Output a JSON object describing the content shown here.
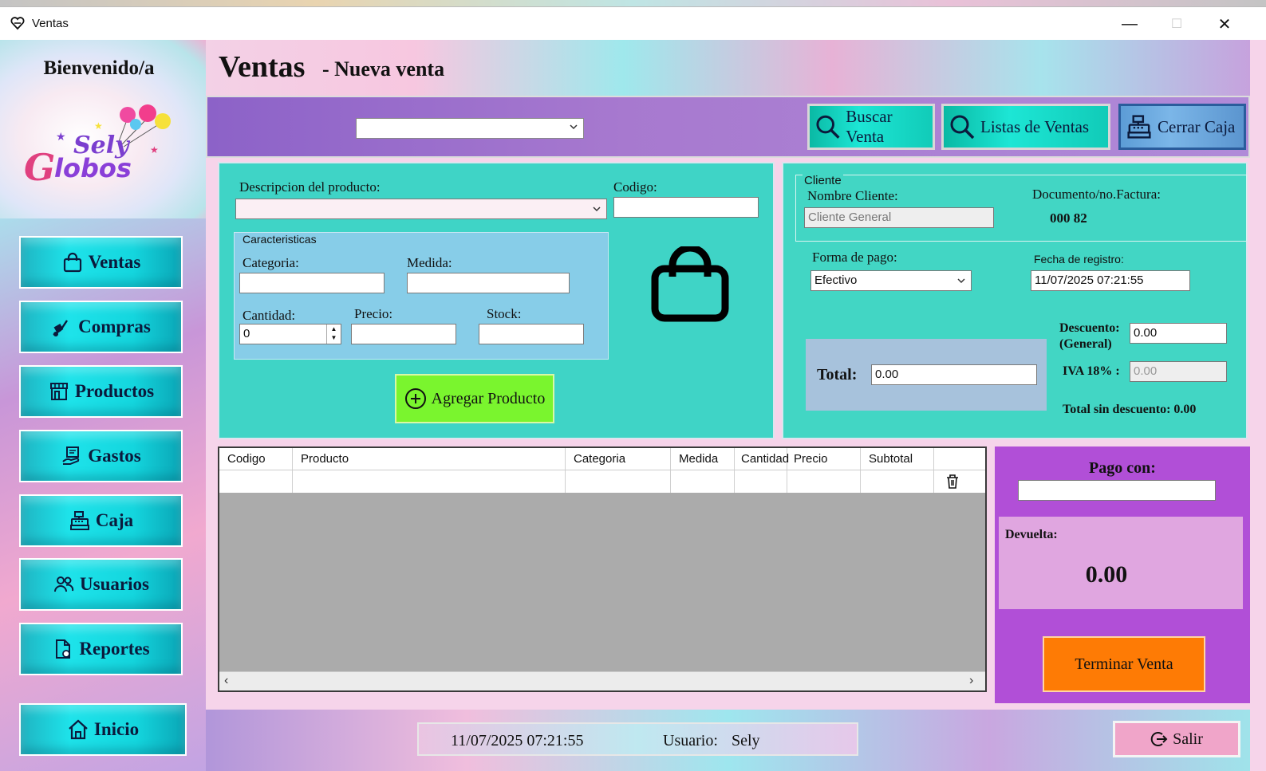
{
  "window": {
    "title": "Ventas"
  },
  "sidebar": {
    "welcome": "Bienvenido/a",
    "logo_text": "Sely Globos",
    "items": [
      {
        "label": "Ventas",
        "icon": "shopping-bag-icon"
      },
      {
        "label": "Compras",
        "icon": "dolly-icon"
      },
      {
        "label": "Productos",
        "icon": "store-icon"
      },
      {
        "label": "Gastos",
        "icon": "expense-icon"
      },
      {
        "label": "Caja",
        "icon": "cash-register-icon"
      },
      {
        "label": "Usuarios",
        "icon": "users-icon"
      },
      {
        "label": "Reportes",
        "icon": "report-icon"
      }
    ],
    "home_label": "Inicio"
  },
  "header": {
    "title": "Ventas",
    "subtitle": "- Nueva venta"
  },
  "toolbar": {
    "combo_value": "",
    "search_sale": "Buscar Venta",
    "sales_lists": "Listas de Ventas",
    "close_register": "Cerrar Caja"
  },
  "product": {
    "description_label": "Descripcion del producto:",
    "description_value": "",
    "code_label": "Codigo:",
    "code_value": "",
    "characteristics_legend": "Caracteristicas",
    "category_label": "Categoria:",
    "category_value": "",
    "measure_label": "Medida:",
    "measure_value": "",
    "quantity_label": "Cantidad:",
    "quantity_value": "0",
    "price_label": "Precio:",
    "price_value": "",
    "stock_label": "Stock:",
    "stock_value": "",
    "add_button": "Agregar Producto"
  },
  "client": {
    "legend": "Cliente",
    "name_label": "Nombre Cliente:",
    "name_value": "Cliente General",
    "doc_label": "Documento/no.Factura:",
    "doc_value": "000 82",
    "payment_label": "Forma de pago:",
    "payment_value": "Efectivo",
    "date_label": "Fecha de registro:",
    "date_value": "11/07/2025  07:21:55",
    "discount_label_1": "Descuento:",
    "discount_label_2": "(General)",
    "discount_value": "0.00",
    "iva_label": "IVA 18% :",
    "iva_value": "0.00",
    "total_label": "Total:",
    "total_value": "0.00",
    "total_no_discount": "Total sin descuento: 0.00"
  },
  "grid": {
    "columns": [
      "Codigo",
      "Producto",
      "Categoria",
      "Medida",
      "Cantidad",
      "Precio",
      "Subtotal",
      ""
    ]
  },
  "payment": {
    "pay_with_label": "Pago con:",
    "pay_with_value": "",
    "change_label": "Devuelta:",
    "change_value": "0.00",
    "finish_button": "Terminar Venta"
  },
  "status": {
    "datetime": "11/07/2025 07:21:55",
    "user_label": "Usuario:",
    "user_value": "Sely",
    "exit_button": "Salir"
  }
}
